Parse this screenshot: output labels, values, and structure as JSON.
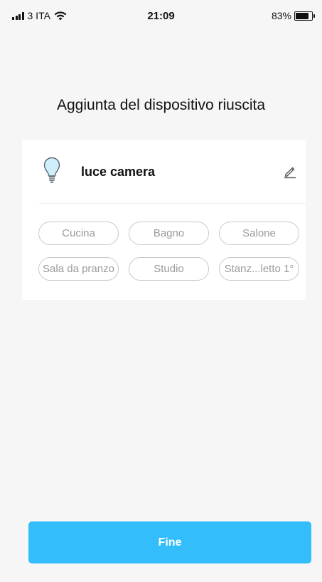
{
  "status_bar": {
    "carrier": "3 ITA",
    "time": "21:09",
    "battery_percent": "83%",
    "battery_level": 0.83
  },
  "page": {
    "title": "Aggiunta del dispositivo riuscita"
  },
  "device": {
    "name": "luce camera",
    "icon": "lightbulb-icon",
    "edit_icon": "pencil-icon"
  },
  "rooms": [
    {
      "label": "Cucina"
    },
    {
      "label": "Bagno"
    },
    {
      "label": "Salone"
    },
    {
      "label": "Sala da pranzo"
    },
    {
      "label": "Studio"
    },
    {
      "label": "Stanz...letto 1°"
    }
  ],
  "actions": {
    "done_label": "Fine"
  },
  "colors": {
    "accent": "#33bdfb",
    "background": "#f6f6f6",
    "chip_text": "#9a9a9a"
  }
}
